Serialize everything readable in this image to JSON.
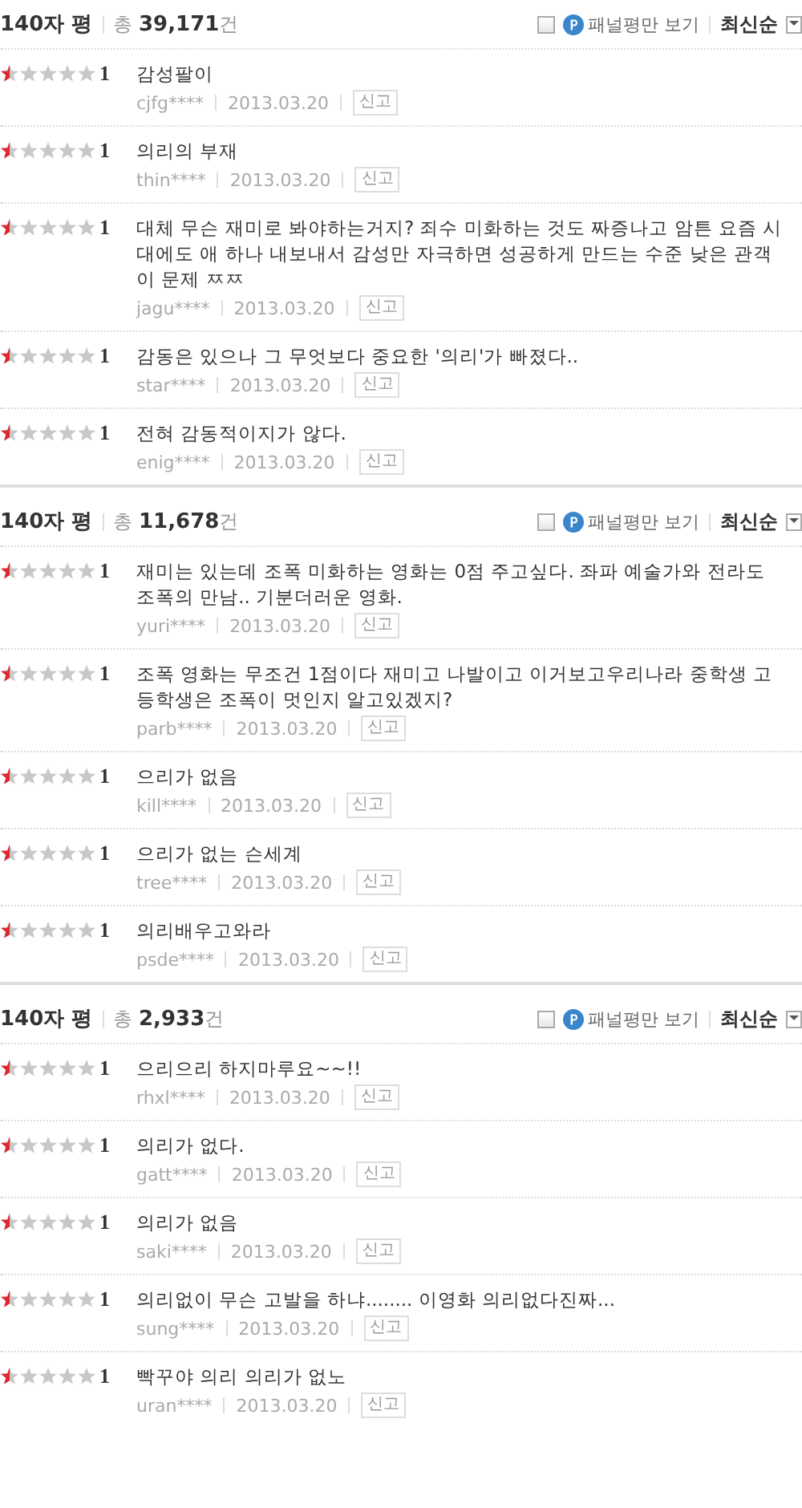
{
  "sections": [
    {
      "title": "140자 평",
      "total_prefix": "총",
      "total_count": "39,171",
      "total_suffix": "건",
      "panel_only": {
        "checked": false,
        "label": "패널평만 보기"
      },
      "sort": "최신순",
      "reviews": [
        {
          "stars": 0.5,
          "score": "1",
          "text": "감성팔이",
          "user": "cjfg****",
          "date": "2013.03.20",
          "report": "신고"
        },
        {
          "stars": 0.5,
          "score": "1",
          "text": "의리의 부재",
          "user": "thin****",
          "date": "2013.03.20",
          "report": "신고"
        },
        {
          "stars": 0.5,
          "score": "1",
          "text": "대체 무슨 재미로 봐야하는거지? 죄수 미화하는 것도 짜증나고 암튼 요즘 시대에도 애 하나 내보내서 감성만 자극하면 성공하게 만드는 수준 낮은 관객이 문제 ㅉㅉ",
          "user": "jagu****",
          "date": "2013.03.20",
          "report": "신고"
        },
        {
          "stars": 0.5,
          "score": "1",
          "text": "감동은 있으나 그 무엇보다 중요한 '의리'가 빠졌다..",
          "user": "star****",
          "date": "2013.03.20",
          "report": "신고"
        },
        {
          "stars": 0.5,
          "score": "1",
          "text": "전혀 감동적이지가 않다.",
          "user": "enig****",
          "date": "2013.03.20",
          "report": "신고"
        }
      ]
    },
    {
      "title": "140자 평",
      "total_prefix": "총",
      "total_count": "11,678",
      "total_suffix": "건",
      "panel_only": {
        "checked": false,
        "label": "패널평만 보기"
      },
      "sort": "최신순",
      "reviews": [
        {
          "stars": 0.5,
          "score": "1",
          "text": "재미는 있는데 조폭 미화하는 영화는 0점 주고싶다. 좌파 예술가와 전라도 조폭의 만남.. 기분더러운 영화.",
          "user": "yuri****",
          "date": "2013.03.20",
          "report": "신고"
        },
        {
          "stars": 0.5,
          "score": "1",
          "text": "조폭 영화는 무조건 1점이다 재미고 나발이고 이거보고우리나라 중학생 고등학생은 조폭이 멋인지 알고있겠지?",
          "user": "parb****",
          "date": "2013.03.20",
          "report": "신고"
        },
        {
          "stars": 0.5,
          "score": "1",
          "text": "으리가 없음",
          "user": "kill****",
          "date": "2013.03.20",
          "report": "신고"
        },
        {
          "stars": 0.5,
          "score": "1",
          "text": "으리가 없는 슨세계",
          "user": "tree****",
          "date": "2013.03.20",
          "report": "신고"
        },
        {
          "stars": 0.5,
          "score": "1",
          "text": "의리배우고와라",
          "user": "psde****",
          "date": "2013.03.20",
          "report": "신고"
        }
      ]
    },
    {
      "title": "140자 평",
      "total_prefix": "총",
      "total_count": "2,933",
      "total_suffix": "건",
      "panel_only": {
        "checked": false,
        "label": "패널평만 보기"
      },
      "sort": "최신순",
      "reviews": [
        {
          "stars": 0.5,
          "score": "1",
          "text": "으리으리 하지마루요~~!!",
          "user": "rhxl****",
          "date": "2013.03.20",
          "report": "신고"
        },
        {
          "stars": 0.5,
          "score": "1",
          "text": "의리가 없다.",
          "user": "gatt****",
          "date": "2013.03.20",
          "report": "신고"
        },
        {
          "stars": 0.5,
          "score": "1",
          "text": "의리가 없음",
          "user": "saki****",
          "date": "2013.03.20",
          "report": "신고"
        },
        {
          "stars": 0.5,
          "score": "1",
          "text": "의리없이 무슨 고발을 하냐........ 이영화 의리없다진짜...",
          "user": "sung****",
          "date": "2013.03.20",
          "report": "신고"
        },
        {
          "stars": 0.5,
          "score": "1",
          "text": "빡꾸야 의리 의리가 없노",
          "user": "uran****",
          "date": "2013.03.20",
          "report": "신고"
        }
      ]
    }
  ]
}
